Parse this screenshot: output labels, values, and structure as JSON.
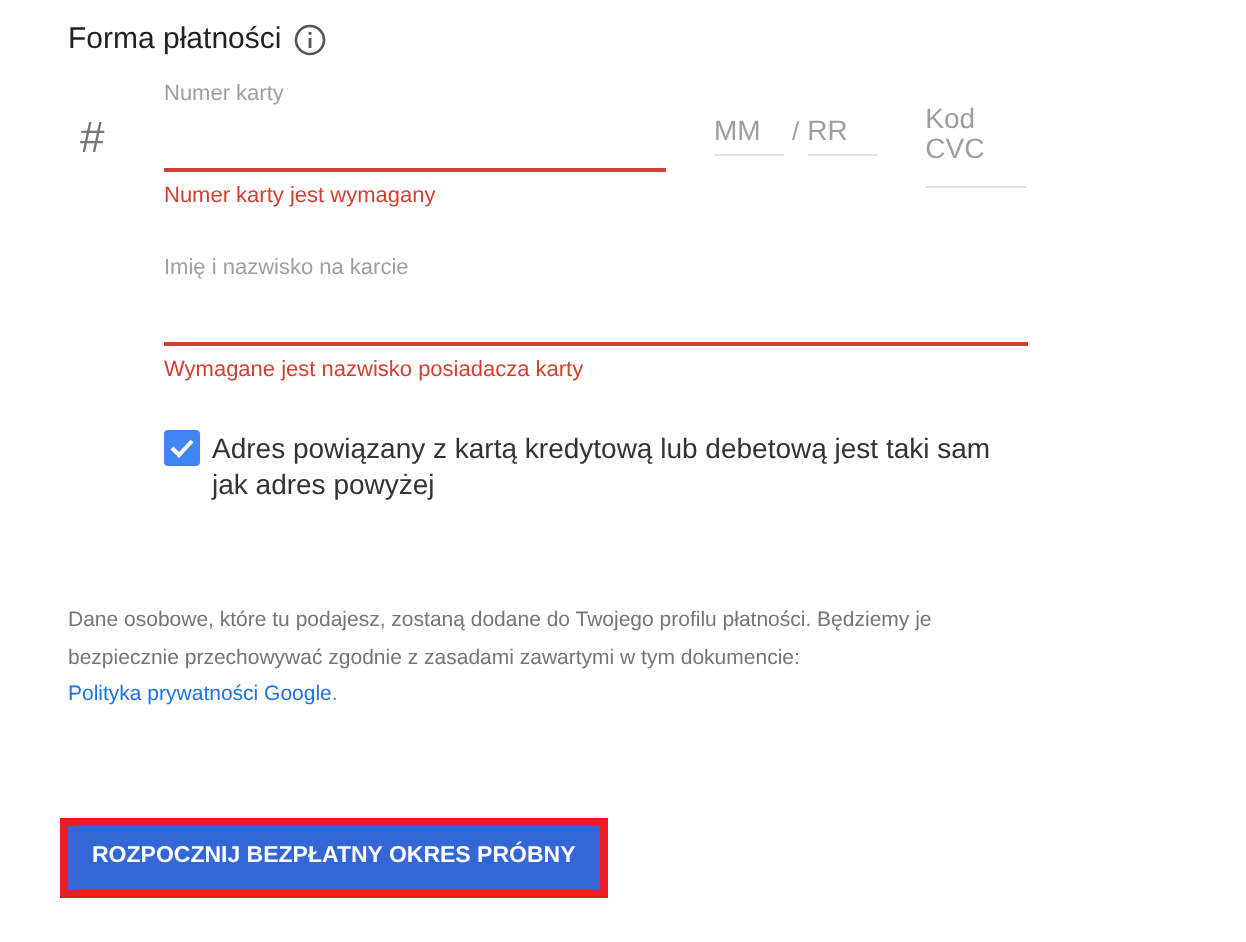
{
  "section": {
    "title": "Forma płatności"
  },
  "card_number": {
    "label": "Numer karty",
    "invalid": true,
    "error": "Numer karty jest wymagany"
  },
  "hash_symbol": "#",
  "expiry": {
    "month": {
      "placeholder": "MM"
    },
    "separator": "/",
    "year": {
      "placeholder": "RR"
    }
  },
  "cvc": {
    "placeholder": "Kod CVC"
  },
  "cardholder": {
    "label": "Imię i nazwisko na karcie",
    "invalid": true,
    "error": "Wymagane jest nazwisko posiadacza karty"
  },
  "same_address": {
    "label": "Adres powiązany z kartą kredytową lub debetową jest taki sam jak adres powyżej",
    "checked": true
  },
  "notice": {
    "text": "Dane osobowe, które tu podajesz, zostaną dodane do Twojego profilu płatności. Będziemy je bezpiecznie przechowywać zgodnie z zasadami zawartymi w tym dokumencie:",
    "link": "Polityka prywatności Google",
    "end": "."
  },
  "submit": {
    "label": "ROZPOCZNIJ BEZPŁATNY OKRES PRÓBNY",
    "highlighted": true
  }
}
